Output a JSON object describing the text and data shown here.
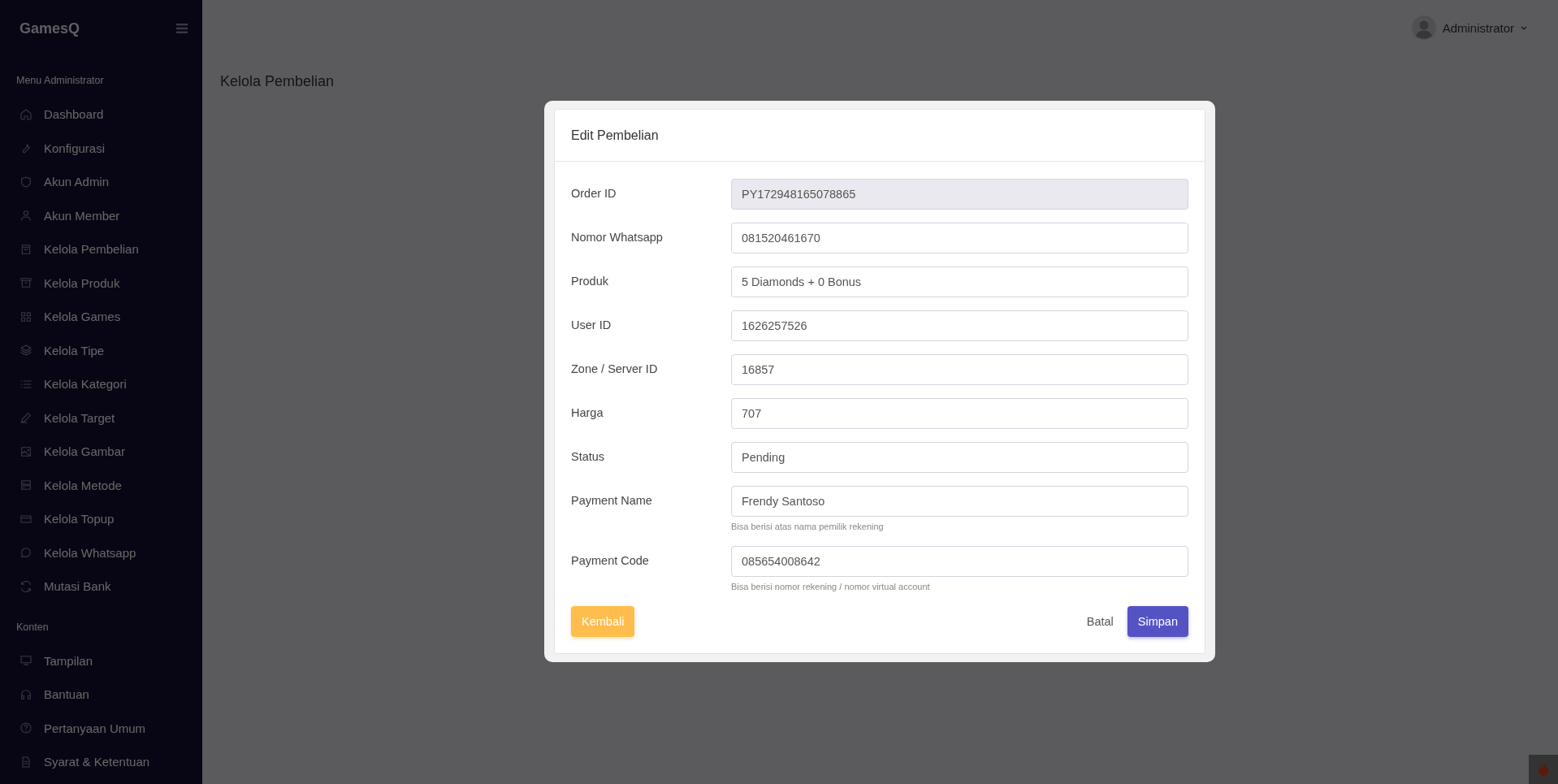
{
  "sidebar": {
    "brand": "GamesQ",
    "sections": [
      {
        "title": "Menu Administrator",
        "items": [
          {
            "label": "Dashboard"
          },
          {
            "label": "Konfigurasi"
          },
          {
            "label": "Akun Admin"
          },
          {
            "label": "Akun Member"
          },
          {
            "label": "Kelola Pembelian"
          },
          {
            "label": "Kelola Produk"
          },
          {
            "label": "Kelola Games"
          },
          {
            "label": "Kelola Tipe"
          },
          {
            "label": "Kelola Kategori"
          },
          {
            "label": "Kelola Target"
          },
          {
            "label": "Kelola Gambar"
          },
          {
            "label": "Kelola Metode"
          },
          {
            "label": "Kelola Topup"
          },
          {
            "label": "Kelola Whatsapp"
          },
          {
            "label": "Mutasi Bank"
          }
        ]
      },
      {
        "title": "Konten",
        "items": [
          {
            "label": "Tampilan"
          },
          {
            "label": "Bantuan"
          },
          {
            "label": "Pertanyaan Umum"
          },
          {
            "label": "Syarat & Ketentuan"
          }
        ]
      }
    ]
  },
  "topbar": {
    "user": "Administrator"
  },
  "page_title": "Kelola Pembelian",
  "modal": {
    "title": "Edit Pembelian",
    "fields": [
      {
        "label": "Order ID",
        "value": "PY172948165078865",
        "disabled": true
      },
      {
        "label": "Nomor Whatsapp",
        "value": "081520461670",
        "disabled": false
      },
      {
        "label": "Produk",
        "value": "5 Diamonds + 0 Bonus",
        "disabled": false
      },
      {
        "label": "User ID",
        "value": "1626257526",
        "disabled": false
      },
      {
        "label": "Zone / Server ID",
        "value": "16857",
        "disabled": false
      },
      {
        "label": "Harga",
        "value": "707",
        "disabled": false
      },
      {
        "label": "Status",
        "value": "Pending",
        "disabled": false
      },
      {
        "label": "Payment Name",
        "value": "Frendy Santoso",
        "disabled": false,
        "help": "Bisa berisi atas nama pemilik rekening"
      },
      {
        "label": "Payment Code",
        "value": "085654008642",
        "disabled": false,
        "help": "Bisa berisi nomor rekening / nomor virtual account"
      }
    ],
    "back_button": "Kembali",
    "cancel_button": "Batal",
    "save_button": "Simpan"
  }
}
